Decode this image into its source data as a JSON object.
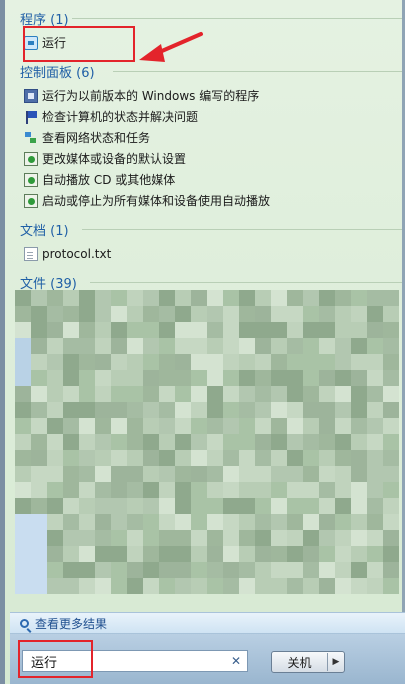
{
  "groups": {
    "programs": {
      "title": "程序 (1)",
      "items": [
        {
          "label": "运行",
          "icon": "run-icon"
        }
      ]
    },
    "control_panel": {
      "title": "控制面板 (6)",
      "items": [
        {
          "label": "运行为以前版本的 Windows 编写的程序",
          "icon": "compat-icon"
        },
        {
          "label": "检查计算机的状态并解决问题",
          "icon": "flag-icon"
        },
        {
          "label": "查看网络状态和任务",
          "icon": "network-icon"
        },
        {
          "label": "更改媒体或设备的默认设置",
          "icon": "media-icon"
        },
        {
          "label": "自动播放 CD 或其他媒体",
          "icon": "media-icon"
        },
        {
          "label": "启动或停止为所有媒体和设备使用自动播放",
          "icon": "media-icon"
        }
      ]
    },
    "documents": {
      "title": "文档 (1)",
      "items": [
        {
          "label": "protocol.txt",
          "icon": "text-file-icon"
        }
      ]
    },
    "files": {
      "title": "文件 (39)"
    }
  },
  "see_more": "查看更多结果",
  "search": {
    "value": "运行"
  },
  "shutdown": {
    "label": "关机"
  },
  "colors": {
    "highlight": "#e3242b",
    "group_title": "#1f5fa6"
  }
}
